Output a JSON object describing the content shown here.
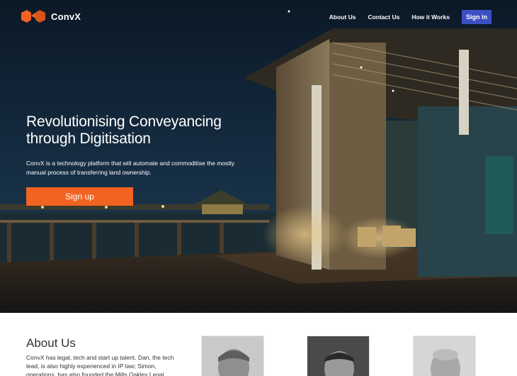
{
  "brand": {
    "name": "ConvX",
    "accent": "#f26322",
    "signin_color": "#3c4fc2"
  },
  "nav": {
    "links": [
      "About Us",
      "Contact Us",
      "How it Works"
    ],
    "signin_label": "Sign in"
  },
  "hero": {
    "title": "Revolutionising Conveyancing through Digitisation",
    "subtitle": "ConvX is a technology platform that will automate and commoditise the mostly manual process of transferring land ownership.",
    "cta_label": "Sign up"
  },
  "about": {
    "title": "About Us",
    "text": "ConvX has legal, tech and start up talent. Dan, the tech lead, is also highly experienced in IP law; Simon, operations, has also founded the Mills Oakley Legal"
  }
}
